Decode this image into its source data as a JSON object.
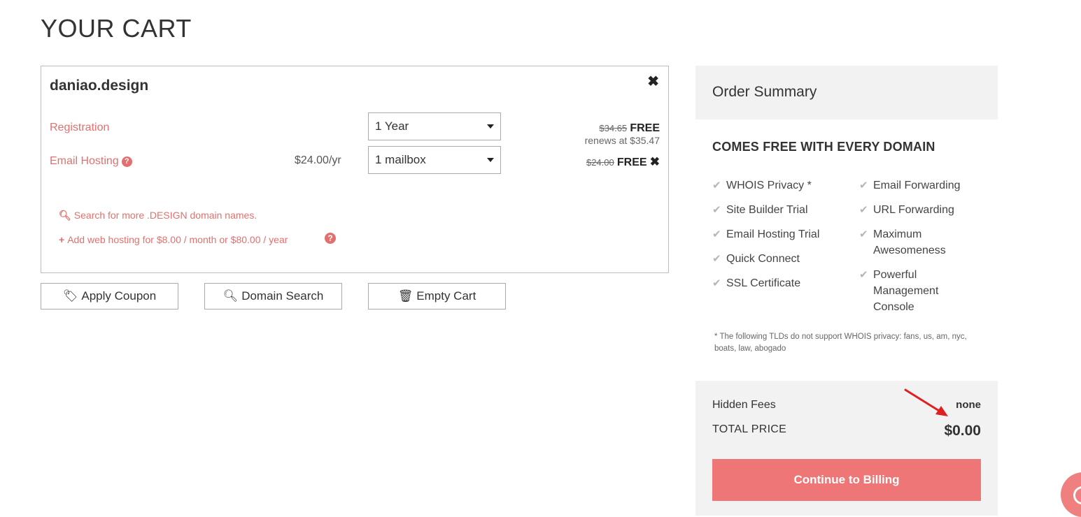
{
  "page": {
    "title": "YOUR CART"
  },
  "cart": {
    "domain": "daniao.design",
    "remove_icon": "close-icon",
    "rows": [
      {
        "label": "Registration",
        "select_value": "1 Year",
        "old_price": "$34.65",
        "new_price": "FREE",
        "renews": "renews at $35.47"
      },
      {
        "label": "Email Hosting",
        "help_icon": "question-circle-icon",
        "unit_price": "$24.00/yr",
        "select_value": "1 mailbox",
        "old_price": "$24.00",
        "new_price": "FREE",
        "remove_icon": "close-icon"
      }
    ],
    "links": {
      "search_more": "Search for more .DESIGN domain names.",
      "add_hosting": "Add web hosting for $8.00 / month or $80.00 / year"
    }
  },
  "buttons": {
    "apply_coupon": "Apply Coupon",
    "domain_search": "Domain Search",
    "empty_cart": "Empty Cart"
  },
  "summary": {
    "title": "Order Summary",
    "free_title": "COMES FREE WITH EVERY DOMAIN",
    "features_left": [
      "WHOIS Privacy *",
      "Site Builder Trial",
      "Email Hosting Trial",
      "Quick Connect",
      "SSL Certificate"
    ],
    "features_right": [
      "Email Forwarding",
      "URL Forwarding",
      "Maximum Awesomeness",
      "Powerful Management Console"
    ],
    "footnote": "* The following TLDs do not support WHOIS privacy: fans, us, am, nyc, boats, law, abogado",
    "hidden_fees_label": "Hidden Fees",
    "hidden_fees_value": "none",
    "total_label": "TOTAL PRICE",
    "total_value": "$0.00",
    "continue_label": "Continue to Billing"
  },
  "colors": {
    "accent": "#e2706e",
    "button": "#ee7676",
    "panel": "#f2f2f2",
    "annotation": "#e02020"
  }
}
